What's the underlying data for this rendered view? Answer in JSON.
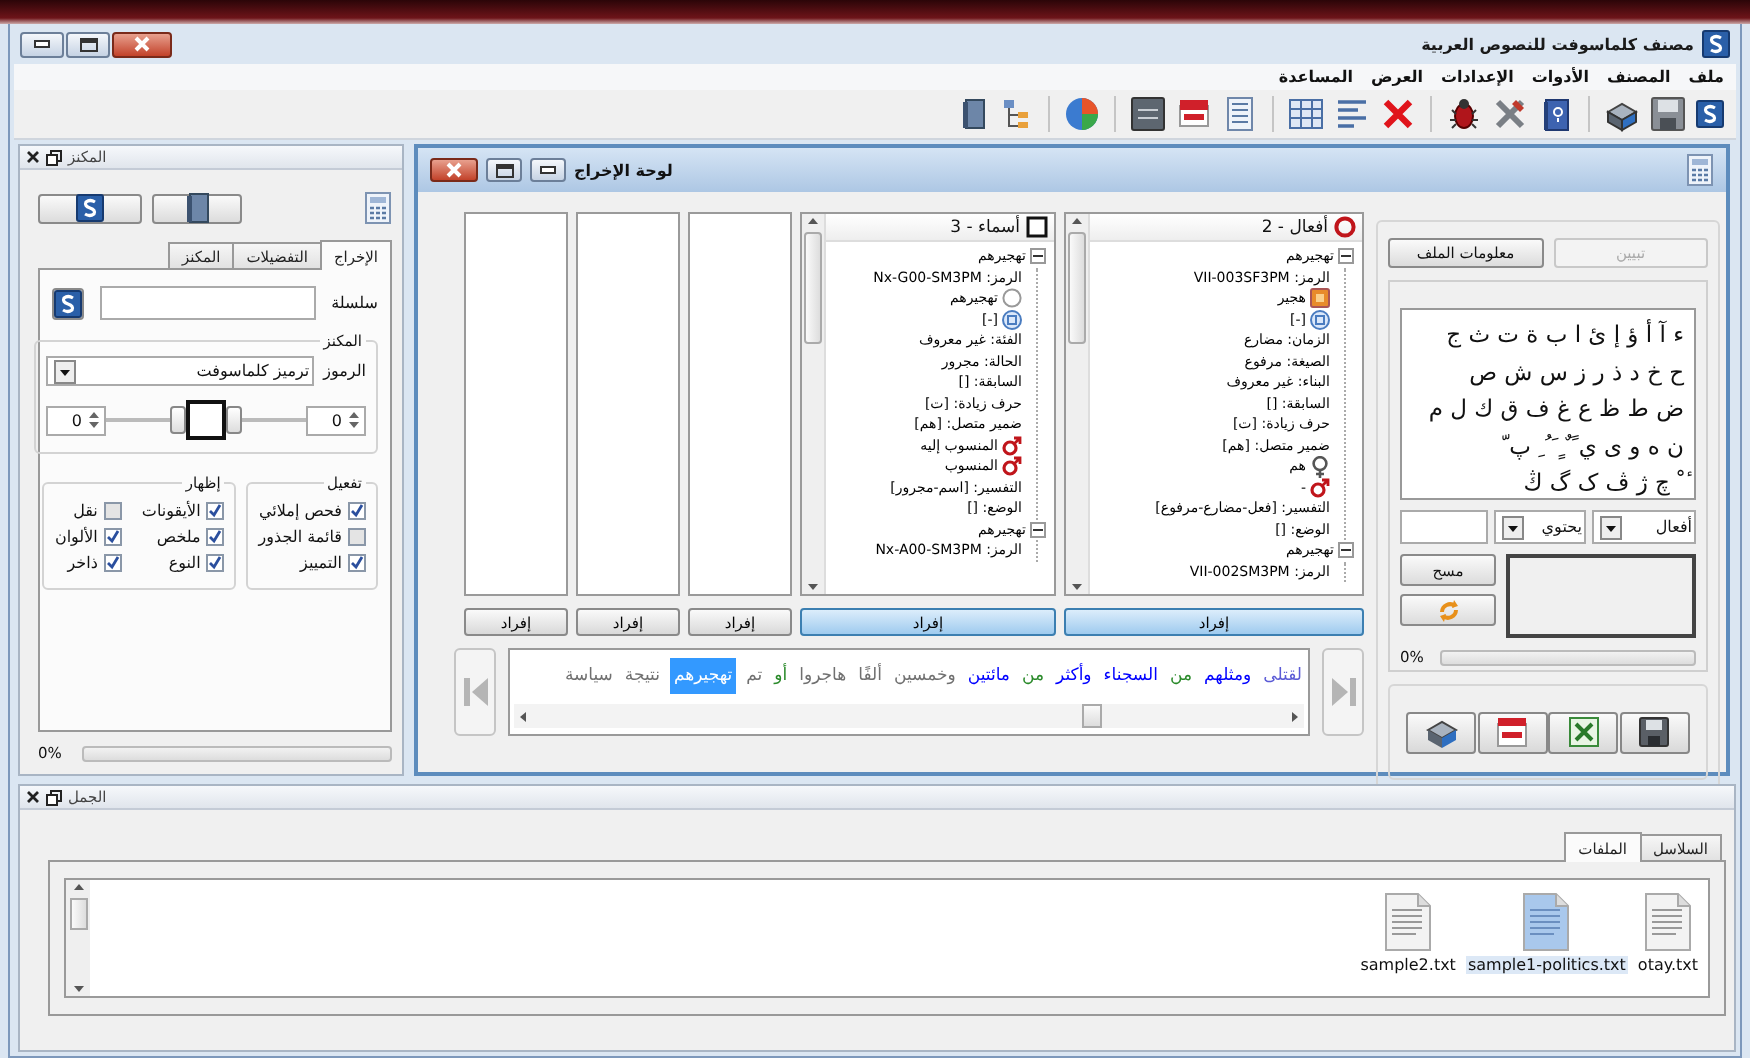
{
  "window": {
    "title": "مصنف كلماسوفت للنصوص العربية"
  },
  "menu": [
    "ملف",
    "المصنف",
    "الأدوات",
    "الإعدادات",
    "العرض",
    "المساعدة"
  ],
  "thesaurus_panel": {
    "title": "المكنز",
    "tabs": [
      {
        "label": "الإخراج",
        "selected": true
      },
      {
        "label": "التفضيلات",
        "selected": false
      },
      {
        "label": "المكنز",
        "selected": false
      }
    ],
    "series_label": "سلسلة",
    "group_title": "المكنز",
    "symbols_label": "الرموز",
    "symbols_value": "ترميز كلماسوفت",
    "spinners": [
      "0",
      "0"
    ],
    "sliders": [
      {
        "level": 0.1
      },
      {
        "level": 0.9
      }
    ],
    "activate": {
      "title": "تفعيل",
      "items": [
        {
          "label": "فحص إملائي",
          "checked": true
        },
        {
          "label": "قائمة الجذور",
          "checked": false
        },
        {
          "label": "التمييز",
          "checked": true
        }
      ]
    },
    "display": {
      "title": "إظهار",
      "items": [
        {
          "label": "الأيقونات",
          "checked": true
        },
        {
          "label": "نقل",
          "checked": false
        },
        {
          "label": "ملخص",
          "checked": true
        },
        {
          "label": "الألوان",
          "checked": true
        },
        {
          "label": "النوع",
          "checked": true
        },
        {
          "label": "ذاخر",
          "checked": true
        }
      ]
    },
    "progress": {
      "reading": "0%",
      "level": 0
    }
  },
  "output_board": {
    "title": "لوحة الإخراج",
    "columns": [
      {
        "header": "أفعال - 2",
        "kind": "verb",
        "selected": true,
        "split_button": "إفراد",
        "tree": [
          {
            "text": "تهجيرهم",
            "expanded": true,
            "children": [
              {
                "text": "الرمز: VII-003SF3PM"
              },
              {
                "text": "هجير",
                "kind": "pattern"
              },
              {
                "text": "[-]",
                "kind": "root"
              },
              {
                "text": "الزمان: مضارع"
              },
              {
                "text": "الصيغة: مرفوع"
              },
              {
                "text": "البناء: غير معروف"
              },
              {
                "text": "السابقة: []"
              },
              {
                "text": "حرف زيادة: [ت]"
              },
              {
                "text": "ضمير متصل: [هم]"
              },
              {
                "text": "هم",
                "kind": "female"
              },
              {
                "text": "-",
                "kind": "male"
              },
              {
                "text": "التفسير: [فعل-مضارع-مرفوع]"
              },
              {
                "text": "الوضع: []"
              }
            ]
          },
          {
            "text": "تهجيرهم",
            "expanded": true,
            "children": [
              {
                "text": "الرمز: VII-002SM3PM"
              }
            ]
          }
        ]
      },
      {
        "header": "أسماء - 3",
        "kind": "noun",
        "selected": true,
        "split_button": "إفراد",
        "tree": [
          {
            "text": "تهجيرهم",
            "expanded": true,
            "children": [
              {
                "text": "الرمز: Nx-G00-SM3PM"
              },
              {
                "text": "تهجيرهم",
                "kind": "stem"
              },
              {
                "text": "[-]",
                "kind": "root"
              },
              {
                "text": "الفئة: غير معروف"
              },
              {
                "text": "الحالة: مجرور"
              },
              {
                "text": "السابقة: []"
              },
              {
                "text": "حرف زيادة: [ت]"
              },
              {
                "text": "ضمير متصل: [هم]"
              },
              {
                "text": "المنسوب إليه",
                "kind": "male"
              },
              {
                "text": "المنسوب",
                "kind": "male"
              },
              {
                "text": "التفسير: [اسم-مجرور]"
              },
              {
                "text": "الوضع: []"
              }
            ]
          },
          {
            "text": "تهجيرهم",
            "expanded": true,
            "children": [
              {
                "text": "الرمز: Nx-A00-SM3PM"
              }
            ]
          }
        ]
      },
      {
        "selected": false,
        "split_button": "إفراد"
      },
      {
        "selected": false,
        "split_button": "إفراد"
      },
      {
        "selected": false,
        "split_button": "إفراد"
      }
    ],
    "words": [
      {
        "text": "لقتلى",
        "color": "#5b5bd6",
        "selected": false
      },
      {
        "text": "ومثلهم",
        "color": "#0000ff",
        "selected": false
      },
      {
        "text": "من",
        "color": "#2a8a2a",
        "selected": false
      },
      {
        "text": "السجناء",
        "color": "#0000ff",
        "selected": false
      },
      {
        "text": "وأكثر",
        "color": "#0000ff",
        "selected": false
      },
      {
        "text": "من",
        "color": "#2a8a2a",
        "selected": false
      },
      {
        "text": "مائتين",
        "color": "#0000ff",
        "selected": false
      },
      {
        "text": "وخمسين",
        "color": "#707070",
        "selected": false
      },
      {
        "text": "ألفًا",
        "color": "#707070",
        "selected": false
      },
      {
        "text": "هاجروا",
        "color": "#707070",
        "selected": false
      },
      {
        "text": "أو",
        "color": "#2a8a2a",
        "selected": false
      },
      {
        "text": "تم",
        "color": "#707070",
        "selected": false
      },
      {
        "text": "تهجيرهم",
        "selected": true
      },
      {
        "text": "نتيجة",
        "color": "#707070",
        "selected": false
      },
      {
        "text": "سياسة",
        "color": "#707070",
        "selected": false
      }
    ],
    "explain_button": {
      "label": "تبيين",
      "disabled": true
    },
    "file_info_button": "معلومات الملف",
    "letters": [
      "ء آ أ ؤ إ ئ ا ب ة ت ث ج",
      "ح خ د ذ ر ز س ش ص",
      "ض ط ظ ع غ ف ق ك ل م",
      "ن ه و ى ي ً ٌ ٍ َ ُ ِ پ ّ",
      "ٔ ْ چ ژ ڤ ک گ ڭ"
    ],
    "category_dropdown": "أفعال",
    "match_dropdown": "يحتوي",
    "clear_button": "مسح",
    "progress": {
      "reading": "0%",
      "level": 0
    }
  },
  "sentences_panel": {
    "title": "الجمل",
    "tabs": [
      {
        "label": "السلاسل",
        "selected": false
      },
      {
        "label": "الملفات",
        "selected": true
      }
    ],
    "files": [
      {
        "name": "otay.txt",
        "selected": false
      },
      {
        "name": "sample1-politics.txt",
        "selected": true
      },
      {
        "name": "sample2.txt",
        "selected": false
      }
    ]
  }
}
